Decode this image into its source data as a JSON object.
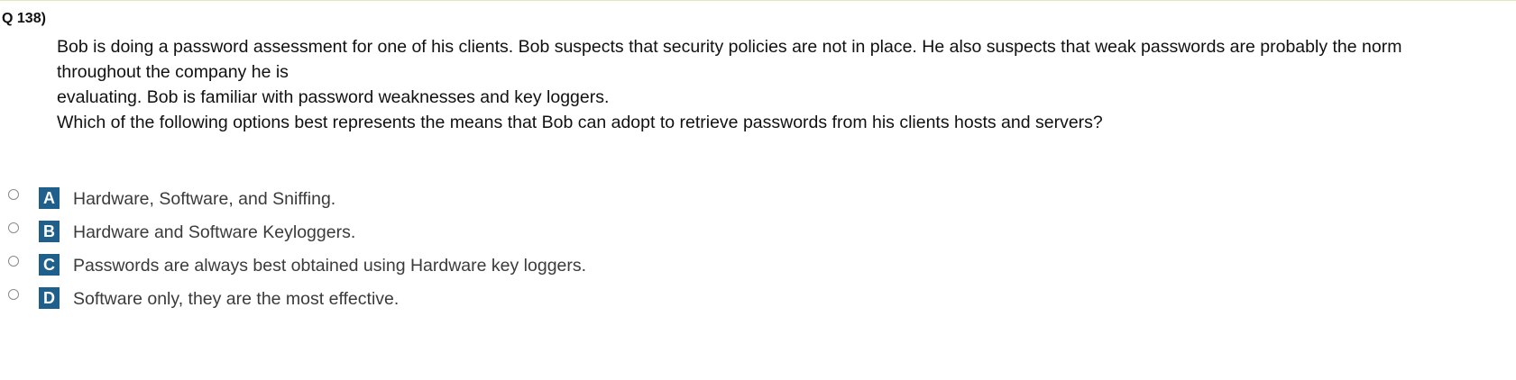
{
  "question": {
    "number": "Q 138)",
    "lines": [
      "Bob is doing a password assessment for one of his clients. Bob suspects that security policies are not in place. He also suspects that weak passwords are probably the norm",
      "throughout the company he is",
      "evaluating. Bob is familiar with password weaknesses and key loggers.",
      "Which of the following options best represents the means that Bob can adopt to retrieve passwords from his clients hosts and servers?"
    ]
  },
  "options": [
    {
      "letter": "A",
      "text": "Hardware, Software, and Sniffing."
    },
    {
      "letter": "B",
      "text": "Hardware and Software Keyloggers."
    },
    {
      "letter": "C",
      "text": "Passwords are always best obtained using Hardware key loggers."
    },
    {
      "letter": "D",
      "text": "Software only, they are the most effective."
    }
  ],
  "colors": {
    "letter_badge": "#1f5f8b",
    "option_text": "#3b3b3b",
    "question_text": "#111111"
  }
}
